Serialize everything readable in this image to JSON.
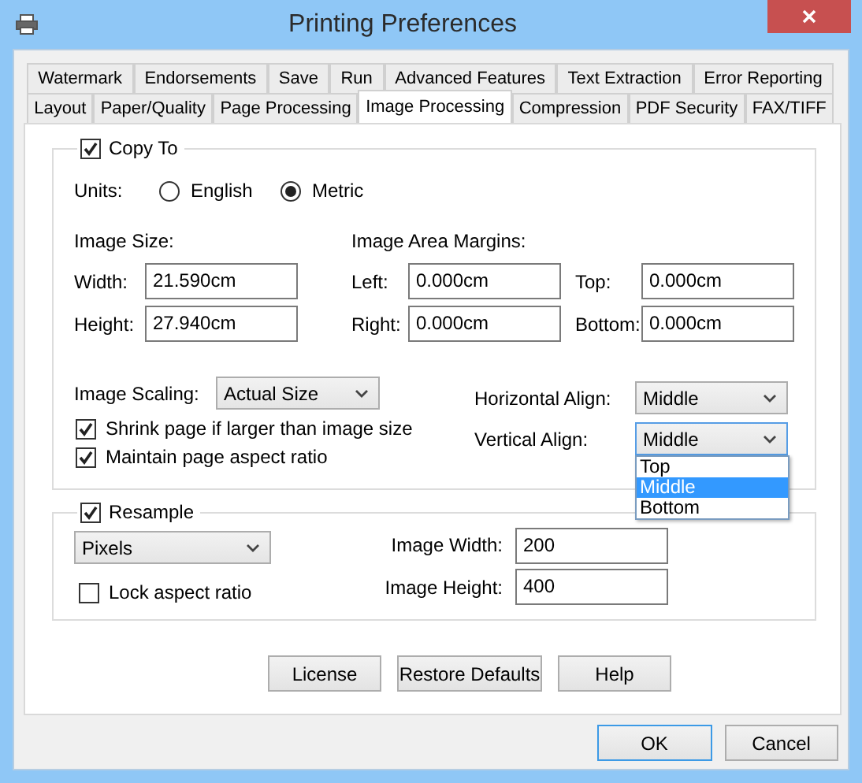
{
  "window": {
    "title": "Printing Preferences"
  },
  "tab_rows": [
    {
      "tabs": [
        {
          "label": "Watermark",
          "selected": false
        },
        {
          "label": "Endorsements",
          "selected": false
        },
        {
          "label": "Save",
          "selected": false
        },
        {
          "label": "Run",
          "selected": false
        },
        {
          "label": "Advanced Features",
          "selected": false
        },
        {
          "label": "Text Extraction",
          "selected": false
        },
        {
          "label": "Error Reporting",
          "selected": false
        }
      ]
    },
    {
      "tabs": [
        {
          "label": "Layout",
          "selected": false
        },
        {
          "label": "Paper/Quality",
          "selected": false
        },
        {
          "label": "Page Processing",
          "selected": false
        },
        {
          "label": "Image Processing",
          "selected": true
        },
        {
          "label": "Compression",
          "selected": false
        },
        {
          "label": "PDF Security",
          "selected": false
        },
        {
          "label": "FAX/TIFF",
          "selected": false
        }
      ]
    }
  ],
  "copy_to": {
    "label": "Copy To",
    "checked": true,
    "units": {
      "label": "Units:",
      "options": [
        {
          "label": "English",
          "selected": false
        },
        {
          "label": "Metric",
          "selected": true
        }
      ]
    },
    "image_size": {
      "heading": "Image Size:",
      "fields": [
        {
          "label": "Width:",
          "value": "21.590cm"
        },
        {
          "label": "Height:",
          "value": "27.940cm"
        }
      ]
    },
    "margins": {
      "heading": "Image Area Margins:",
      "fields": [
        {
          "label": "Left:",
          "value": "0.000cm"
        },
        {
          "label": "Top:",
          "value": "0.000cm"
        },
        {
          "label": "Right:",
          "value": "0.000cm"
        },
        {
          "label": "Bottom:",
          "value": "0.000cm"
        }
      ]
    },
    "image_scaling": {
      "label": "Image Scaling:",
      "value": "Actual Size"
    },
    "options": [
      {
        "label": "Shrink page if larger than image size",
        "checked": true
      },
      {
        "label": "Maintain page aspect ratio",
        "checked": true
      }
    ],
    "horizontal_align": {
      "label": "Horizontal Align:",
      "value": "Middle"
    },
    "vertical_align": {
      "label": "Vertical Align:",
      "value": "Middle",
      "expanded": true,
      "options": [
        {
          "label": "Top",
          "selected": false
        },
        {
          "label": "Middle",
          "selected": true
        },
        {
          "label": "Bottom",
          "selected": false
        }
      ]
    }
  },
  "resample": {
    "label": "Resample",
    "checked": true,
    "unit": "Pixels",
    "lock": {
      "label": "Lock aspect ratio",
      "checked": false
    },
    "fields": [
      {
        "label": "Image Width:",
        "value": "200"
      },
      {
        "label": "Image Height:",
        "value": "400"
      }
    ]
  },
  "page_buttons": [
    "License",
    "Restore Defaults",
    "Help"
  ],
  "dialog_buttons": [
    {
      "label": "OK",
      "default": true
    },
    {
      "label": "Cancel",
      "default": false
    }
  ]
}
